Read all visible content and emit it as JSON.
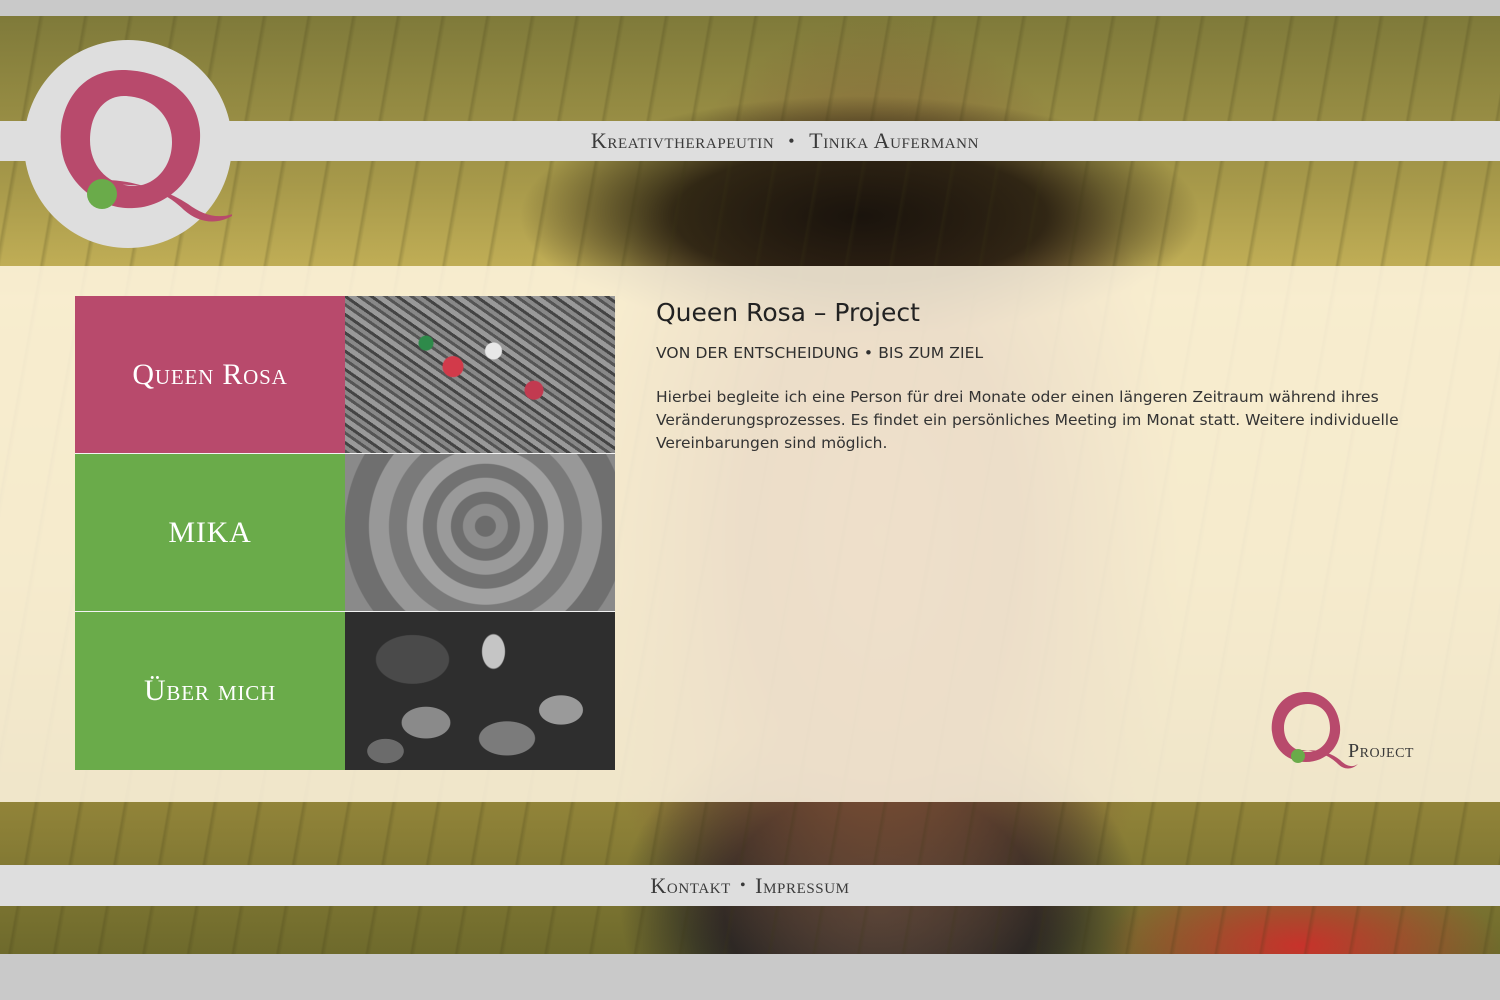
{
  "header": {
    "profession": "Kreativtherapeutin",
    "separator": "•",
    "name": "Tinika Aufermann"
  },
  "logo": {
    "letter": "Q",
    "colors": {
      "primary": "#b84a6c",
      "accent": "#6aab4a"
    }
  },
  "nav_tiles": [
    {
      "label": "Queen Rosa",
      "color": "#b84a6c",
      "image": "art-supplies-photo"
    },
    {
      "label": "MIKA",
      "color": "#6aab4a",
      "image": "swirl-painting-photo"
    },
    {
      "label": "Über mich",
      "color": "#6aab4a",
      "image": "frog-figurine-rocks-photo"
    }
  ],
  "article": {
    "title": "Queen Rosa – Project",
    "subtitle": "VON DER ENTSCHEIDUNG • BIS ZUM ZIEL",
    "body": "Hierbei begleite ich eine Person für drei Monate oder einen längeren Zeitraum während ihres Veränderungsprozesses. Es findet ein persönliches Meeting im Monat statt. Weitere individuelle Vereinbarungen sind möglich."
  },
  "q_project": {
    "label": "Project"
  },
  "footer": {
    "contact": "Kontakt",
    "separator": "•",
    "imprint": "Impressum"
  }
}
